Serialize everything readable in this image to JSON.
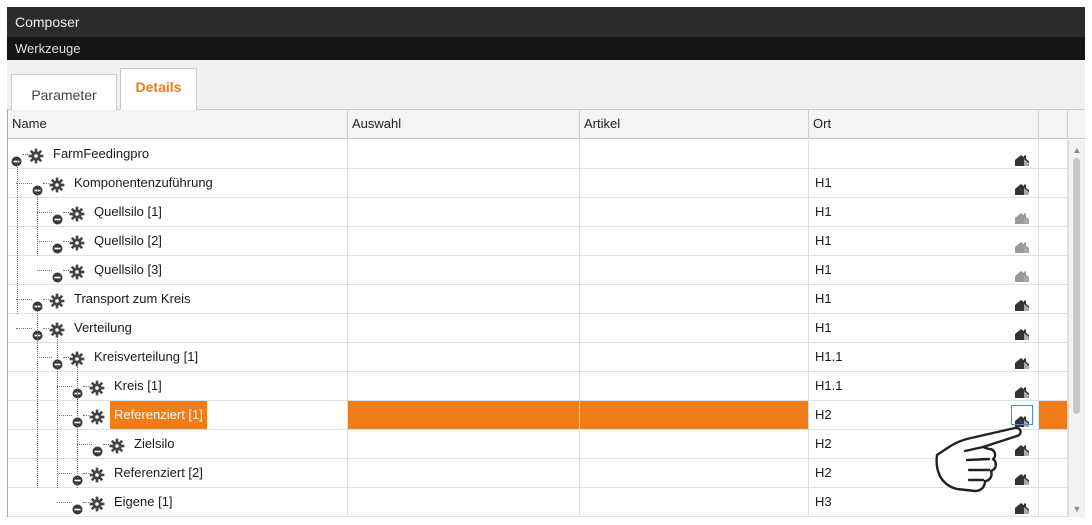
{
  "window": {
    "title": "Composer",
    "menu": "Werkzeuge"
  },
  "tabs": [
    {
      "label": "Parameter",
      "active": false
    },
    {
      "label": "Details",
      "active": true
    }
  ],
  "columns": [
    "Name",
    "Auswahl",
    "Artikel",
    "Ort"
  ],
  "rows": [
    {
      "name": "FarmFeedingpro",
      "ort": "",
      "selected": false
    },
    {
      "name": "Komponentenzuführung",
      "ort": "H1",
      "selected": false
    },
    {
      "name": "Quellsilo [1]",
      "ort": "H1",
      "selected": false
    },
    {
      "name": "Quellsilo [2]",
      "ort": "H1",
      "selected": false
    },
    {
      "name": "Quellsilo [3]",
      "ort": "H1",
      "selected": false
    },
    {
      "name": "Transport zum Kreis",
      "ort": "H1",
      "selected": false
    },
    {
      "name": "Verteilung",
      "ort": "H1",
      "selected": false
    },
    {
      "name": "Kreisverteilung [1]",
      "ort": "H1.1",
      "selected": false
    },
    {
      "name": "Kreis [1]",
      "ort": "H1.1",
      "selected": false
    },
    {
      "name": "Referenziert [1]",
      "ort": "H2",
      "selected": true
    },
    {
      "name": "Zielsilo",
      "ort": "H2",
      "selected": false
    },
    {
      "name": "Referenziert [2]",
      "ort": "H2",
      "selected": false
    },
    {
      "name": "Eigene [1]",
      "ort": "H3",
      "selected": false
    }
  ],
  "colors": {
    "accent": "#f07d1a",
    "title_bar": "#2b2b2b",
    "menu_bar": "#141414"
  },
  "icons": {
    "tree_node": "gear-icon",
    "location": "house-icon",
    "expander": "expander-icon",
    "pointer": "pointing-hand-icon"
  }
}
